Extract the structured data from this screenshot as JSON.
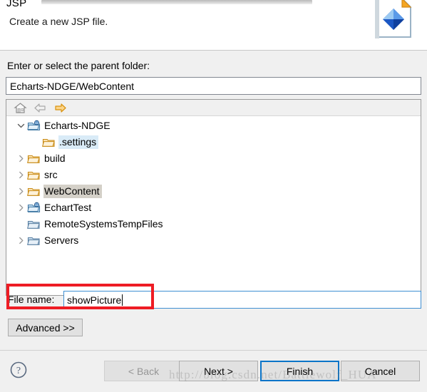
{
  "header": {
    "title": "JSP",
    "subtitle": "Create a new JSP file.",
    "icon": "jsp-file-icon"
  },
  "parent_folder": {
    "label": "Enter or select the parent folder:",
    "value": "Echarts-NDGE/WebContent",
    "placeholder": ""
  },
  "tree_toolbar": {
    "home": "home-icon",
    "back": "back-arrow-icon",
    "forward": "forward-arrow-icon"
  },
  "tree": {
    "items": [
      {
        "label": "Echarts-NDGE",
        "icon": "project-icon",
        "indent": 0,
        "twisty": "down",
        "selected": "none"
      },
      {
        "label": ".settings",
        "icon": "folder-orange-icon",
        "indent": 2,
        "twisty": "none",
        "selected": "blue"
      },
      {
        "label": "build",
        "icon": "folder-orange-icon",
        "indent": 1,
        "twisty": "right",
        "selected": "none"
      },
      {
        "label": "src",
        "icon": "folder-orange-icon",
        "indent": 1,
        "twisty": "right",
        "selected": "none"
      },
      {
        "label": "WebContent",
        "icon": "folder-orange-icon",
        "indent": 1,
        "twisty": "right",
        "selected": "grey"
      },
      {
        "label": "EchartTest",
        "icon": "project-icon",
        "indent": 0,
        "twisty": "right",
        "selected": "none"
      },
      {
        "label": "RemoteSystemsTempFiles",
        "icon": "folder-blue-icon",
        "indent": 0,
        "twisty": "none",
        "selected": "none"
      },
      {
        "label": "Servers",
        "icon": "folder-blue-icon",
        "indent": 0,
        "twisty": "right",
        "selected": "none"
      }
    ]
  },
  "file_name": {
    "label": "File name:",
    "value": "showPicture",
    "placeholder": ""
  },
  "advanced": {
    "label": "Advanced >>"
  },
  "footer": {
    "help": "help-icon",
    "back_label": "< Back",
    "next_label": "Next >",
    "finish_label": "Finish",
    "cancel_label": "Cancel"
  },
  "watermark": {
    "text": "http://blog.csdn.net/Battlewolf_HUA"
  },
  "colors": {
    "accent": "#0a74c8",
    "annotation": "#ee1c24",
    "folder_orange": "#f0a830",
    "folder_blue": "#8fb6d8",
    "selection_blue": "#d9ebf7",
    "selection_grey": "#d4d0c8"
  }
}
